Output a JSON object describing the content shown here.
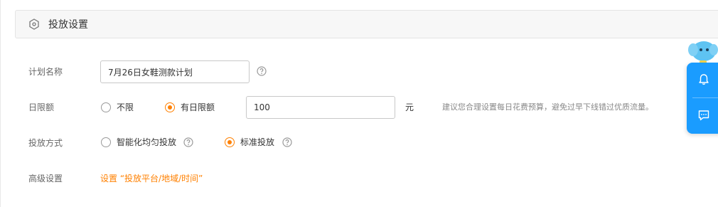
{
  "section": {
    "title": "投放设置",
    "icon": "hexagon-icon"
  },
  "plan_name": {
    "label": "计划名称",
    "value": "7月26日女鞋测款计划",
    "help_icon": "question-circle-icon"
  },
  "daily_limit": {
    "label": "日限额",
    "options": [
      {
        "label": "不限",
        "checked": false
      },
      {
        "label": "有日限额",
        "checked": true
      }
    ],
    "amount": "100",
    "unit": "元",
    "hint": "建议您合理设置每日花费预算，避免过早下线错过优质流量。"
  },
  "delivery_method": {
    "label": "投放方式",
    "options": [
      {
        "label": "智能化均匀投放",
        "checked": false
      },
      {
        "label": "标准投放",
        "checked": true
      }
    ]
  },
  "advanced": {
    "label": "高级设置",
    "link": "设置 “投放平台/地域/时间”"
  },
  "float_panel": {
    "icons": [
      "bell-icon",
      "chat-icon"
    ],
    "mascot": "elephant-mascot-icon"
  },
  "colors": {
    "accent": "#ff8000",
    "panel": "#1a9cff"
  }
}
